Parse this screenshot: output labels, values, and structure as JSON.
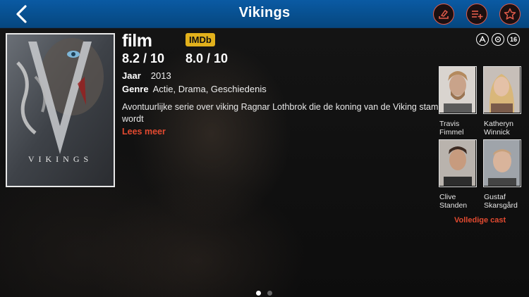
{
  "header": {
    "title": "Vikings",
    "back_icon": "chevron-left-icon",
    "actions": [
      {
        "icon": "share-icon"
      },
      {
        "icon": "add-to-list-icon"
      },
      {
        "icon": "favorite-star-icon"
      }
    ],
    "bar_color": "#0a5aa3",
    "accent_color": "#e25b4a"
  },
  "poster": {
    "wordmark": "VIKINGS"
  },
  "ratings": {
    "film_logo": "film",
    "film_score": "8.2 / 10",
    "imdb_logo": "IMDb",
    "imdb_score": "8.0 / 10"
  },
  "kijkwijzer": [
    {
      "icon": "violence-icon"
    },
    {
      "icon": "fear-icon"
    },
    {
      "label": "16"
    }
  ],
  "info": {
    "year_label": "Jaar",
    "year": "2013",
    "genre_label": "Genre",
    "genre": "Actie, Drama, Geschiedenis"
  },
  "description": "Avontuurlijke serie over viking Ragnar Lothbrok die de koning van de Viking stam wordt",
  "read_more": "Lees meer",
  "cast": [
    {
      "first": "Travis",
      "last": "Fimmel"
    },
    {
      "first": "Katheryn",
      "last": "Winnick"
    },
    {
      "first": "Clive",
      "last": "Standen"
    },
    {
      "first": "Gustaf",
      "last": "Skarsgård"
    }
  ],
  "full_cast": "Volledige cast",
  "pager": {
    "count": 2,
    "active": 1
  },
  "link_color": "#e34a30"
}
